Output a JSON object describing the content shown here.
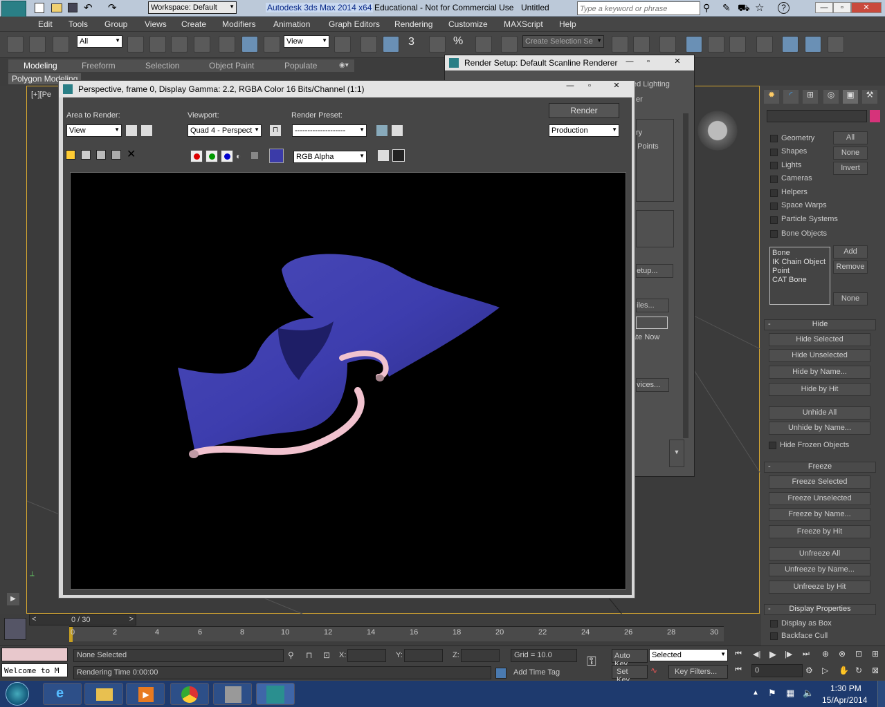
{
  "titlebar": {
    "workspace": "Workspace: Default",
    "app_title": "Autodesk 3ds Max  2014 x64",
    "edition": "Educational - Not for Commercial Use",
    "doc": "Untitled",
    "search_placeholder": "Type a keyword or phrase"
  },
  "menu": [
    "Edit",
    "Tools",
    "Group",
    "Views",
    "Create",
    "Modifiers",
    "Animation",
    "Graph Editors",
    "Rendering",
    "Customize",
    "MAXScript",
    "Help"
  ],
  "toolbar": {
    "filter": "All",
    "coord": "View",
    "selection_set": "Create Selection Se",
    "snap": "3",
    "angle": "%"
  },
  "ribbon": {
    "tabs": [
      "Modeling",
      "Freeform",
      "Selection",
      "Object Paint",
      "Populate"
    ],
    "sub": "Polygon Modeling"
  },
  "viewport_label": "[+][Pe",
  "render_setup": {
    "title": "Render Setup: Default Scanline Renderer",
    "bits": [
      "ed Lighting",
      "er",
      "ry",
      ": Points",
      "etup...",
      "iles...",
      "ate Now",
      "vices..."
    ]
  },
  "frame_window": {
    "title": "Perspective, frame 0, Display Gamma: 2.2, RGBA Color 16 Bits/Channel (1:1)",
    "area_label": "Area to Render:",
    "area_value": "View",
    "viewport_label": "Viewport:",
    "viewport_value": "Quad 4 - Perspect",
    "preset_label": "Render Preset:",
    "preset_value": "--------------------",
    "render_button": "Render",
    "production": "Production",
    "channel": "RGB Alpha",
    "swatch_color": "#3b3ba8"
  },
  "command_panel": {
    "geometry": "Geometry",
    "shapes": "Shapes",
    "lights": "Lights",
    "cameras": "Cameras",
    "helpers": "Helpers",
    "spacewarps": "Space Warps",
    "particles": "Particle Systems",
    "bones": "Bone Objects",
    "all": "All",
    "none": "None",
    "invert": "Invert",
    "list": [
      "Bone",
      "IK Chain Object",
      "Point",
      "CAT Bone"
    ],
    "add": "Add",
    "remove": "Remove",
    "none2": "None",
    "hide_head": "Hide",
    "hide_buttons": [
      "Hide Selected",
      "Hide Unselected",
      "Hide by Name...",
      "Hide by Hit",
      "Unhide All",
      "Unhide by Name..."
    ],
    "hide_frozen": "Hide Frozen Objects",
    "freeze_head": "Freeze",
    "freeze_buttons": [
      "Freeze Selected",
      "Freeze Unselected",
      "Freeze by Name...",
      "Freeze by Hit",
      "Unfreeze All",
      "Unfreeze by Name...",
      "Unfreeze by Hit"
    ],
    "display_head": "Display Properties",
    "display_box": "Display as Box",
    "backface": "Backface Cull"
  },
  "timeline": {
    "counter": "0 / 30",
    "ticks": [
      "0",
      "2",
      "4",
      "6",
      "8",
      "10",
      "12",
      "14",
      "16",
      "18",
      "20",
      "22",
      "24",
      "26",
      "28",
      "30"
    ]
  },
  "status": {
    "script": "Welcome to M",
    "selection": "None Selected",
    "render_time": "Rendering Time  0:00:00",
    "x": "X:",
    "y": "Y:",
    "z": "Z:",
    "grid": "Grid = 10.0",
    "add_tag": "Add Time Tag",
    "auto_key": "Auto Key",
    "set_key": "Set Key",
    "selected": "Selected",
    "key_filters": "Key Filters...",
    "frame": "0"
  },
  "clock": {
    "time": "1:30 PM",
    "date": "15/Apr/2014"
  }
}
